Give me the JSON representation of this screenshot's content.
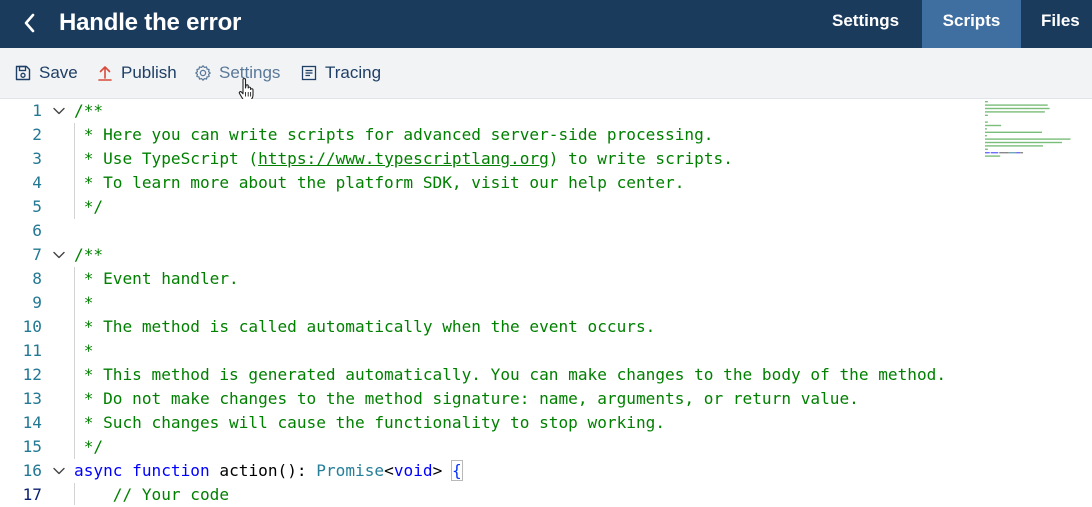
{
  "header": {
    "title": "Handle the error",
    "back_icon": "chevron-left-icon",
    "tabs": [
      {
        "label": "Settings",
        "active": false
      },
      {
        "label": "Scripts",
        "active": true
      },
      {
        "label": "Files",
        "active": false
      }
    ]
  },
  "toolbar": {
    "save_label": "Save",
    "publish_label": "Publish",
    "settings_label": "Settings",
    "tracing_label": "Tracing"
  },
  "colors": {
    "header_bg": "#1b3b5d",
    "active_tab_bg": "#3f6ea0",
    "toolbar_bg": "#f1f3f5",
    "comment": "#008000",
    "keyword": "#0000ff",
    "type": "#267f99",
    "line_number": "#237893"
  },
  "editor": {
    "active_line": 17,
    "lines": [
      {
        "n": "1",
        "fold": true,
        "t": [
          {
            "s": "/**",
            "k": "c"
          }
        ]
      },
      {
        "n": "2",
        "t": [
          {
            "s": " * Here you can write scripts for advanced server-side processing.",
            "k": "c"
          }
        ]
      },
      {
        "n": "3",
        "t": [
          {
            "s": " * Use TypeScript (",
            "k": "c"
          },
          {
            "s": "https://www.typescriptlang.org",
            "k": "link"
          },
          {
            "s": ") to write scripts.",
            "k": "c"
          }
        ]
      },
      {
        "n": "4",
        "t": [
          {
            "s": " * To learn more about the platform SDK, visit our help center.",
            "k": "c"
          }
        ]
      },
      {
        "n": "5",
        "t": [
          {
            "s": " */",
            "k": "c"
          }
        ]
      },
      {
        "n": "6",
        "t": []
      },
      {
        "n": "7",
        "fold": true,
        "t": [
          {
            "s": "/**",
            "k": "c"
          }
        ]
      },
      {
        "n": "8",
        "t": [
          {
            "s": " * Event handler.",
            "k": "c"
          }
        ]
      },
      {
        "n": "9",
        "t": [
          {
            "s": " *",
            "k": "c"
          }
        ]
      },
      {
        "n": "10",
        "t": [
          {
            "s": " * The method is called automatically when the event occurs.",
            "k": "c"
          }
        ]
      },
      {
        "n": "11",
        "t": [
          {
            "s": " *",
            "k": "c"
          }
        ]
      },
      {
        "n": "12",
        "t": [
          {
            "s": " * This method is generated automatically. You can make changes to the body of the method.",
            "k": "c"
          }
        ]
      },
      {
        "n": "13",
        "t": [
          {
            "s": " * Do not make changes to the method signature: name, arguments, or return value.",
            "k": "c"
          }
        ]
      },
      {
        "n": "14",
        "t": [
          {
            "s": " * Such changes will cause the functionality to stop working.",
            "k": "c"
          }
        ]
      },
      {
        "n": "15",
        "t": [
          {
            "s": " */",
            "k": "c"
          }
        ]
      },
      {
        "n": "16",
        "fold": true,
        "t": [
          {
            "s": "async",
            "k": "kw"
          },
          {
            "s": " ",
            "k": "pl"
          },
          {
            "s": "function",
            "k": "kw"
          },
          {
            "s": " ",
            "k": "pl"
          },
          {
            "s": "action",
            "k": "fn"
          },
          {
            "s": "(): ",
            "k": "pl"
          },
          {
            "s": "Promise",
            "k": "ty"
          },
          {
            "s": "<",
            "k": "pl"
          },
          {
            "s": "void",
            "k": "kw"
          },
          {
            "s": "> ",
            "k": "pl"
          },
          {
            "s": "{",
            "k": "br"
          }
        ]
      },
      {
        "n": "17",
        "t": [
          {
            "s": "    // Your code",
            "k": "c"
          }
        ]
      }
    ]
  }
}
